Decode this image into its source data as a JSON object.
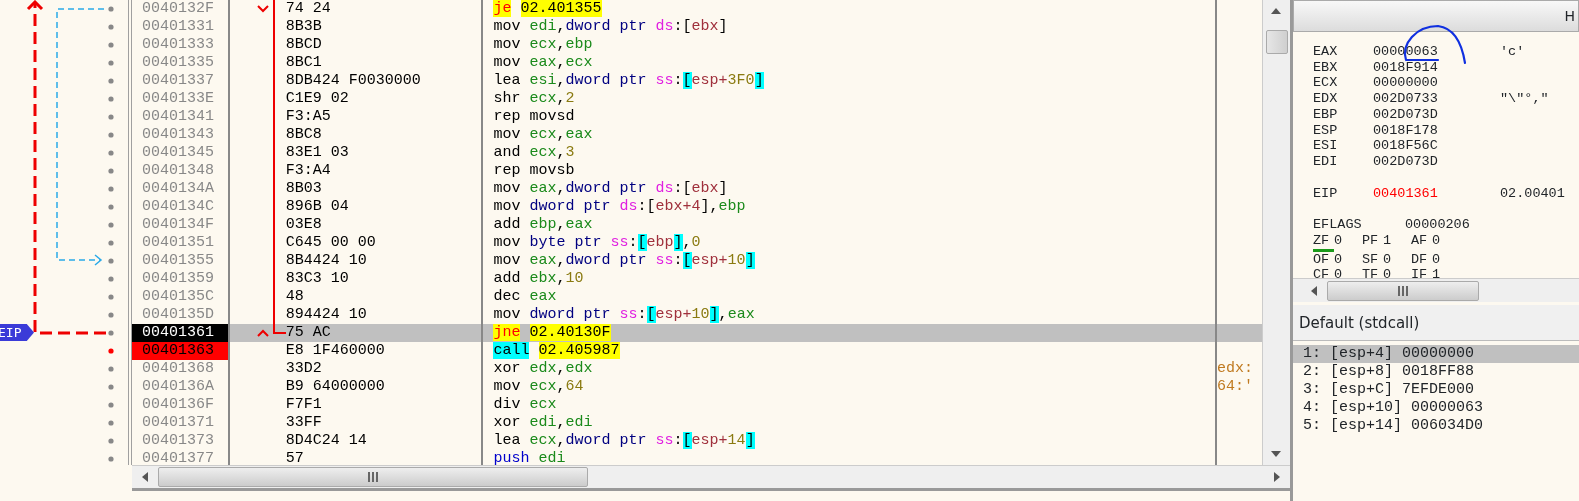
{
  "eip_label": "EIP",
  "rows": [
    {
      "address": "0040132F",
      "bytes": "74 24",
      "mnemonic": {
        "text": "je",
        "kind": "jump"
      },
      "operands": [
        {
          "text": "02.401355",
          "kind": "target"
        }
      ],
      "selected": false,
      "eip": false,
      "breakpoint": false
    },
    {
      "address": "00401331",
      "bytes": "8B3B",
      "mnemonic": {
        "text": "mov",
        "kind": "plain"
      },
      "operands": [
        {
          "text": "edi",
          "kind": "reg"
        },
        {
          "text": ",",
          "kind": "punct"
        },
        {
          "text": "dword ptr",
          "kind": "size"
        },
        {
          "text": "ds",
          "kind": "seg"
        },
        {
          "text": ":[",
          "kind": "punct"
        },
        {
          "text": "ebx",
          "kind": "mem"
        },
        {
          "text": "]",
          "kind": "punct"
        }
      ],
      "selected": false,
      "eip": false,
      "breakpoint": false
    },
    {
      "address": "00401333",
      "bytes": "8BCD",
      "mnemonic": {
        "text": "mov",
        "kind": "plain"
      },
      "operands": [
        {
          "text": "ecx",
          "kind": "reg"
        },
        {
          "text": ",",
          "kind": "punct"
        },
        {
          "text": "ebp",
          "kind": "reg"
        }
      ],
      "selected": false,
      "eip": false,
      "breakpoint": false
    },
    {
      "address": "00401335",
      "bytes": "8BC1",
      "mnemonic": {
        "text": "mov",
        "kind": "plain"
      },
      "operands": [
        {
          "text": "eax",
          "kind": "reg"
        },
        {
          "text": ",",
          "kind": "punct"
        },
        {
          "text": "ecx",
          "kind": "reg"
        }
      ],
      "selected": false,
      "eip": false,
      "breakpoint": false
    },
    {
      "address": "00401337",
      "bytes": "8DB424 F0030000",
      "mnemonic": {
        "text": "lea",
        "kind": "plain"
      },
      "operands": [
        {
          "text": "esi",
          "kind": "reg"
        },
        {
          "text": ",",
          "kind": "punct"
        },
        {
          "text": "dword ptr",
          "kind": "size"
        },
        {
          "text": "ss",
          "kind": "seg"
        },
        {
          "text": ":",
          "kind": "punct"
        },
        {
          "text": "[",
          "kind": "bracket"
        },
        {
          "text": "esp+",
          "kind": "mem"
        },
        {
          "text": "3F0",
          "kind": "num"
        },
        {
          "text": "]",
          "kind": "bracket"
        }
      ],
      "selected": false,
      "eip": false,
      "breakpoint": false
    },
    {
      "address": "0040133E",
      "bytes": "C1E9 02",
      "mnemonic": {
        "text": "shr",
        "kind": "plain"
      },
      "operands": [
        {
          "text": "ecx",
          "kind": "reg"
        },
        {
          "text": ",",
          "kind": "punct"
        },
        {
          "text": "2",
          "kind": "num"
        }
      ],
      "selected": false,
      "eip": false,
      "breakpoint": false
    },
    {
      "address": "00401341",
      "bytes": "F3:A5",
      "mnemonic": {
        "text": "rep movsd",
        "kind": "plain"
      },
      "operands": [],
      "selected": false,
      "eip": false,
      "breakpoint": false
    },
    {
      "address": "00401343",
      "bytes": "8BC8",
      "mnemonic": {
        "text": "mov",
        "kind": "plain"
      },
      "operands": [
        {
          "text": "ecx",
          "kind": "reg"
        },
        {
          "text": ",",
          "kind": "punct"
        },
        {
          "text": "eax",
          "kind": "reg"
        }
      ],
      "selected": false,
      "eip": false,
      "breakpoint": false
    },
    {
      "address": "00401345",
      "bytes": "83E1 03",
      "mnemonic": {
        "text": "and",
        "kind": "plain"
      },
      "operands": [
        {
          "text": "ecx",
          "kind": "reg"
        },
        {
          "text": ",",
          "kind": "punct"
        },
        {
          "text": "3",
          "kind": "num"
        }
      ],
      "selected": false,
      "eip": false,
      "breakpoint": false
    },
    {
      "address": "00401348",
      "bytes": "F3:A4",
      "mnemonic": {
        "text": "rep movsb",
        "kind": "plain"
      },
      "operands": [],
      "selected": false,
      "eip": false,
      "breakpoint": false
    },
    {
      "address": "0040134A",
      "bytes": "8B03",
      "mnemonic": {
        "text": "mov",
        "kind": "plain"
      },
      "operands": [
        {
          "text": "eax",
          "kind": "reg"
        },
        {
          "text": ",",
          "kind": "punct"
        },
        {
          "text": "dword ptr",
          "kind": "size"
        },
        {
          "text": "ds",
          "kind": "seg"
        },
        {
          "text": ":[",
          "kind": "punct"
        },
        {
          "text": "ebx",
          "kind": "mem"
        },
        {
          "text": "]",
          "kind": "punct"
        }
      ],
      "selected": false,
      "eip": false,
      "breakpoint": false
    },
    {
      "address": "0040134C",
      "bytes": "896B 04",
      "mnemonic": {
        "text": "mov",
        "kind": "plain"
      },
      "operands": [
        {
          "text": "dword ptr",
          "kind": "size"
        },
        {
          "text": "ds",
          "kind": "seg"
        },
        {
          "text": ":[",
          "kind": "punct"
        },
        {
          "text": "ebx+4",
          "kind": "mem"
        },
        {
          "text": "],",
          "kind": "punct"
        },
        {
          "text": "ebp",
          "kind": "reg"
        }
      ],
      "selected": false,
      "eip": false,
      "breakpoint": false
    },
    {
      "address": "0040134F",
      "bytes": "03E8",
      "mnemonic": {
        "text": "add",
        "kind": "plain"
      },
      "operands": [
        {
          "text": "ebp",
          "kind": "reg"
        },
        {
          "text": ",",
          "kind": "punct"
        },
        {
          "text": "eax",
          "kind": "reg"
        }
      ],
      "selected": false,
      "eip": false,
      "breakpoint": false
    },
    {
      "address": "00401351",
      "bytes": "C645 00 00",
      "mnemonic": {
        "text": "mov",
        "kind": "plain"
      },
      "operands": [
        {
          "text": "byte ptr",
          "kind": "size"
        },
        {
          "text": "ss",
          "kind": "seg"
        },
        {
          "text": ":",
          "kind": "punct"
        },
        {
          "text": "[",
          "kind": "bracket"
        },
        {
          "text": "ebp",
          "kind": "mem"
        },
        {
          "text": "]",
          "kind": "bracket"
        },
        {
          "text": ",",
          "kind": "punct"
        },
        {
          "text": "0",
          "kind": "num"
        }
      ],
      "selected": false,
      "eip": false,
      "breakpoint": false
    },
    {
      "address": "00401355",
      "bytes": "8B4424 10",
      "mnemonic": {
        "text": "mov",
        "kind": "plain"
      },
      "operands": [
        {
          "text": "eax",
          "kind": "reg"
        },
        {
          "text": ",",
          "kind": "punct"
        },
        {
          "text": "dword ptr",
          "kind": "size"
        },
        {
          "text": "ss",
          "kind": "seg"
        },
        {
          "text": ":",
          "kind": "punct"
        },
        {
          "text": "[",
          "kind": "bracket"
        },
        {
          "text": "esp+",
          "kind": "mem"
        },
        {
          "text": "10",
          "kind": "num"
        },
        {
          "text": "]",
          "kind": "bracket"
        }
      ],
      "selected": false,
      "eip": false,
      "breakpoint": false
    },
    {
      "address": "00401359",
      "bytes": "83C3 10",
      "mnemonic": {
        "text": "add",
        "kind": "plain"
      },
      "operands": [
        {
          "text": "ebx",
          "kind": "reg"
        },
        {
          "text": ",",
          "kind": "punct"
        },
        {
          "text": "10",
          "kind": "num"
        }
      ],
      "selected": false,
      "eip": false,
      "breakpoint": false
    },
    {
      "address": "0040135C",
      "bytes": "48",
      "mnemonic": {
        "text": "dec",
        "kind": "plain"
      },
      "operands": [
        {
          "text": "eax",
          "kind": "reg"
        }
      ],
      "selected": false,
      "eip": false,
      "breakpoint": false
    },
    {
      "address": "0040135D",
      "bytes": "894424 10",
      "mnemonic": {
        "text": "mov",
        "kind": "plain"
      },
      "operands": [
        {
          "text": "dword ptr",
          "kind": "size"
        },
        {
          "text": "ss",
          "kind": "seg"
        },
        {
          "text": ":",
          "kind": "punct"
        },
        {
          "text": "[",
          "kind": "bracket"
        },
        {
          "text": "esp+",
          "kind": "mem"
        },
        {
          "text": "10",
          "kind": "num"
        },
        {
          "text": "]",
          "kind": "bracket"
        },
        {
          "text": ",",
          "kind": "punct"
        },
        {
          "text": "eax",
          "kind": "reg"
        }
      ],
      "selected": false,
      "eip": false,
      "breakpoint": false
    },
    {
      "address": "00401361",
      "bytes": "75 AC",
      "mnemonic": {
        "text": "jne",
        "kind": "jump"
      },
      "operands": [
        {
          "text": "02.40130F",
          "kind": "target"
        }
      ],
      "selected": true,
      "eip": true,
      "breakpoint": false
    },
    {
      "address": "00401363",
      "bytes": "E8 1F460000",
      "mnemonic": {
        "text": "call",
        "kind": "call"
      },
      "operands": [
        {
          "text": "02.405987",
          "kind": "target"
        }
      ],
      "selected": false,
      "eip": false,
      "breakpoint": true
    },
    {
      "address": "00401368",
      "bytes": "33D2",
      "mnemonic": {
        "text": "xor",
        "kind": "plain"
      },
      "operands": [
        {
          "text": "edx",
          "kind": "reg"
        },
        {
          "text": ",",
          "kind": "punct"
        },
        {
          "text": "edx",
          "kind": "reg"
        }
      ],
      "comment": "edx:",
      "selected": false,
      "eip": false,
      "breakpoint": false
    },
    {
      "address": "0040136A",
      "bytes": "B9 64000000",
      "mnemonic": {
        "text": "mov",
        "kind": "plain"
      },
      "operands": [
        {
          "text": "ecx",
          "kind": "reg"
        },
        {
          "text": ",",
          "kind": "punct"
        },
        {
          "text": "64",
          "kind": "num"
        }
      ],
      "comment": "64:'",
      "selected": false,
      "eip": false,
      "breakpoint": false
    },
    {
      "address": "0040136F",
      "bytes": "F7F1",
      "mnemonic": {
        "text": "div",
        "kind": "plain"
      },
      "operands": [
        {
          "text": "ecx",
          "kind": "reg"
        }
      ],
      "selected": false,
      "eip": false,
      "breakpoint": false
    },
    {
      "address": "00401371",
      "bytes": "33FF",
      "mnemonic": {
        "text": "xor",
        "kind": "plain"
      },
      "operands": [
        {
          "text": "edi",
          "kind": "reg"
        },
        {
          "text": ",",
          "kind": "punct"
        },
        {
          "text": "edi",
          "kind": "reg"
        }
      ],
      "selected": false,
      "eip": false,
      "breakpoint": false
    },
    {
      "address": "00401373",
      "bytes": "8D4C24 14",
      "mnemonic": {
        "text": "lea",
        "kind": "plain"
      },
      "operands": [
        {
          "text": "ecx",
          "kind": "reg"
        },
        {
          "text": ",",
          "kind": "punct"
        },
        {
          "text": "dword ptr",
          "kind": "size"
        },
        {
          "text": "ss",
          "kind": "seg"
        },
        {
          "text": ":",
          "kind": "punct"
        },
        {
          "text": "[",
          "kind": "bracket"
        },
        {
          "text": "esp+",
          "kind": "mem"
        },
        {
          "text": "14",
          "kind": "num"
        },
        {
          "text": "]",
          "kind": "bracket"
        }
      ],
      "selected": false,
      "eip": false,
      "breakpoint": false
    },
    {
      "address": "00401377",
      "bytes": "57",
      "mnemonic": {
        "text": "push",
        "kind": "push"
      },
      "operands": [
        {
          "text": "edi",
          "kind": "reg"
        }
      ],
      "selected": false,
      "eip": false,
      "breakpoint": false
    }
  ],
  "registers_header": "H",
  "registers": [
    {
      "name": "EAX",
      "value": "00000063",
      "comment": "'c'",
      "changed": false
    },
    {
      "name": "EBX",
      "value": "0018F914",
      "changed": false
    },
    {
      "name": "ECX",
      "value": "00000000",
      "changed": false
    },
    {
      "name": "EDX",
      "value": "002D0733",
      "comment": "\"\\\"°,\"",
      "changed": false
    },
    {
      "name": "EBP",
      "value": "002D073D",
      "changed": false
    },
    {
      "name": "ESP",
      "value": "0018F178",
      "changed": false
    },
    {
      "name": "ESI",
      "value": "0018F56C",
      "changed": false
    },
    {
      "name": "EDI",
      "value": "002D073D",
      "changed": false
    }
  ],
  "eip_register": {
    "name": "EIP",
    "value": "00401361",
    "comment": "02.00401",
    "changed": true
  },
  "eflags": {
    "name": "EFLAGS",
    "value": "00000206"
  },
  "flags": [
    [
      {
        "name": "ZF",
        "value": "0",
        "underlined": true
      },
      {
        "name": "PF",
        "value": "1",
        "underlined": false
      },
      {
        "name": "AF",
        "value": "0",
        "underlined": false
      }
    ],
    [
      {
        "name": "OF",
        "value": "0",
        "underlined": false
      },
      {
        "name": "SF",
        "value": "0",
        "underlined": false
      },
      {
        "name": "DF",
        "value": "0",
        "underlined": false
      }
    ],
    [
      {
        "name": "CF",
        "value": "0",
        "underlined": false
      },
      {
        "name": "TF",
        "value": "0",
        "underlined": false
      },
      {
        "name": "IF",
        "value": "1",
        "underlined": false
      }
    ]
  ],
  "call_convention": "Default (stdcall)",
  "stack_args": [
    {
      "text": "1: [esp+4] 00000000",
      "selected": true
    },
    {
      "text": "2: [esp+8] 0018FF88",
      "selected": false
    },
    {
      "text": "3: [esp+C] 7EFDE000",
      "selected": false
    },
    {
      "text": "4: [esp+10] 00000063",
      "selected": false
    },
    {
      "text": "5: [esp+14] 006034D0",
      "selected": false
    }
  ]
}
